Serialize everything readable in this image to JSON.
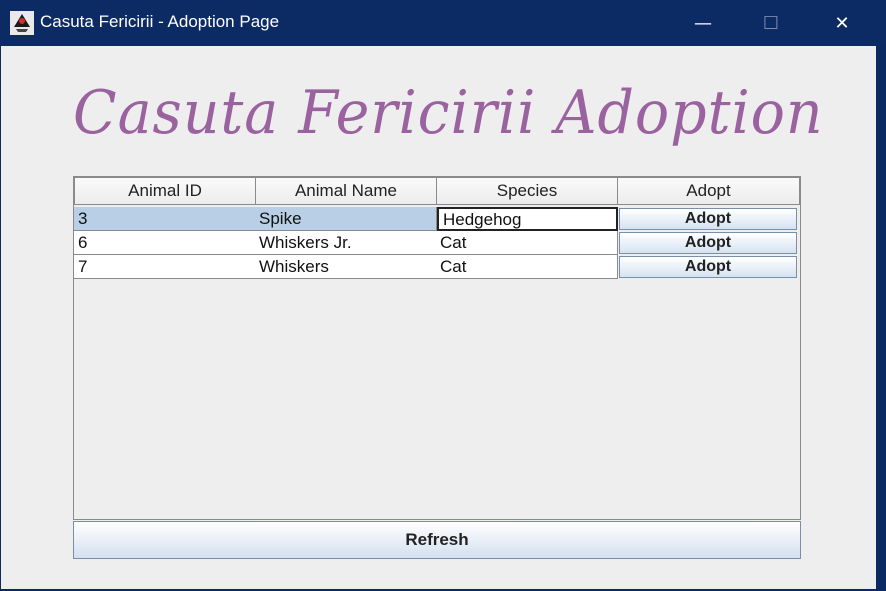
{
  "window": {
    "title": "Casuta Fericirii - Adoption Page",
    "minimize_glyph": "—",
    "maximize_glyph": "☐",
    "close_glyph": "✕",
    "app_icon": "java-duke-icon"
  },
  "heading": "Casuta Fericirii Adoption",
  "table": {
    "columns": [
      "Animal ID",
      "Animal Name",
      "Species",
      "Adopt"
    ],
    "rows": [
      {
        "id": "3",
        "name": "Spike",
        "species": "Hedgehog",
        "action": "Adopt",
        "selected": true,
        "editing_species": true
      },
      {
        "id": "6",
        "name": "Whiskers Jr.",
        "species": "Cat",
        "action": "Adopt",
        "selected": false
      },
      {
        "id": "7",
        "name": "Whiskers",
        "species": "Cat",
        "action": "Adopt",
        "selected": false
      }
    ]
  },
  "refresh_label": "Refresh",
  "colors": {
    "titlebar": "#0c2b65",
    "heading": "#9b62a0",
    "selected_row": "#b8cfe5",
    "background": "#eeeeee"
  }
}
